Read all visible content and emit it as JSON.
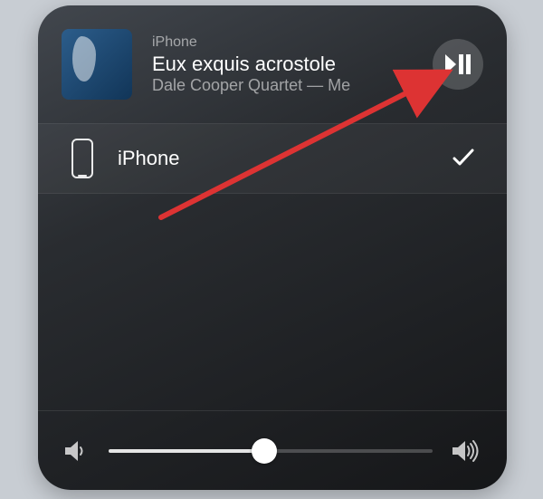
{
  "now_playing": {
    "device_label": "iPhone",
    "title": "Eux exquis acrostole",
    "artist": "Dale Cooper Quartet — Me"
  },
  "devices": [
    {
      "name": "iPhone",
      "selected": true
    }
  ],
  "volume": {
    "percent": 48
  }
}
